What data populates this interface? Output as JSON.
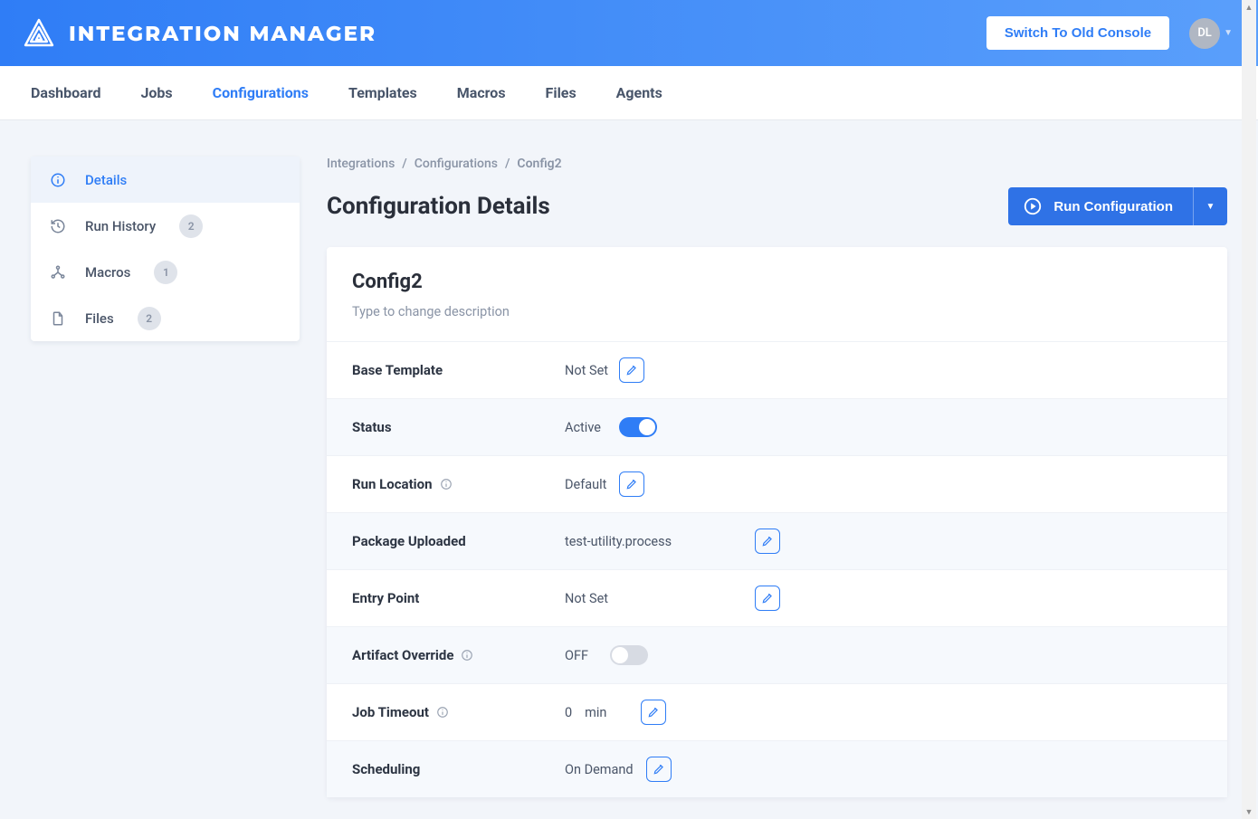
{
  "header": {
    "app_name": "INTEGRATION MANAGER",
    "switch_label": "Switch To Old Console",
    "avatar_initials": "DL"
  },
  "nav": {
    "items": [
      "Dashboard",
      "Jobs",
      "Configurations",
      "Templates",
      "Macros",
      "Files",
      "Agents"
    ],
    "active_index": 2
  },
  "sidebar": {
    "items": [
      {
        "label": "Details",
        "badge": null
      },
      {
        "label": "Run History",
        "badge": "2"
      },
      {
        "label": "Macros",
        "badge": "1"
      },
      {
        "label": "Files",
        "badge": "2"
      }
    ],
    "active_index": 0
  },
  "breadcrumb": {
    "items": [
      "Integrations",
      "Configurations"
    ],
    "current": "Config2"
  },
  "page": {
    "title": "Configuration Details",
    "run_label": "Run Configuration"
  },
  "config": {
    "name": "Config2",
    "description_placeholder": "Type to change description",
    "rows": {
      "base_template": {
        "label": "Base Template",
        "value": "Not Set"
      },
      "status": {
        "label": "Status",
        "value": "Active",
        "on": true
      },
      "run_location": {
        "label": "Run Location",
        "value": "Default"
      },
      "package_uploaded": {
        "label": "Package Uploaded",
        "value": "test-utility.process"
      },
      "entry_point": {
        "label": "Entry Point",
        "value": "Not Set"
      },
      "artifact_override": {
        "label": "Artifact Override",
        "value": "OFF",
        "on": false
      },
      "job_timeout": {
        "label": "Job Timeout",
        "value": "0",
        "unit": "min"
      },
      "scheduling": {
        "label": "Scheduling",
        "value": "On Demand"
      }
    }
  }
}
